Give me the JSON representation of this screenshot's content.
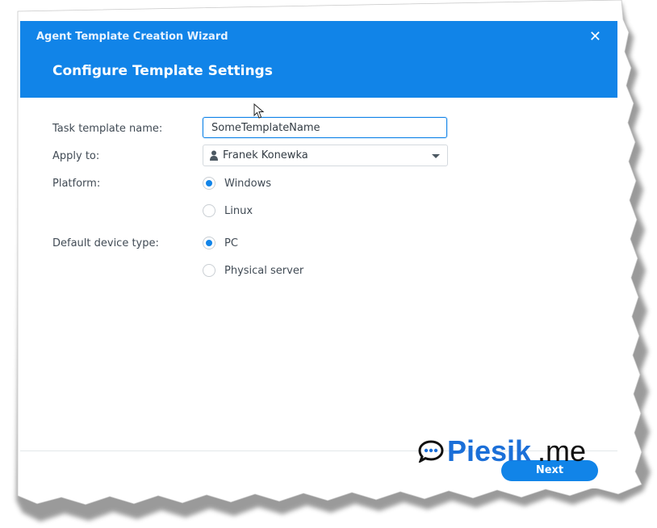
{
  "wizard": {
    "title": "Agent Template Creation Wizard",
    "step_title": "Configure Template Settings",
    "close_glyph": "✕"
  },
  "form": {
    "template_name_label": "Task template name:",
    "template_name_value": "SomeTemplateName",
    "apply_to_label": "Apply to:",
    "apply_to_value": "Franek Konewka",
    "apply_to_icon": "user-icon",
    "platform_label": "Platform:",
    "platform_options": [
      {
        "label": "Windows",
        "checked": true
      },
      {
        "label": "Linux",
        "checked": false
      }
    ],
    "device_type_label": "Default device type:",
    "device_type_options": [
      {
        "label": "PC",
        "checked": true
      },
      {
        "label": "Physical server",
        "checked": false
      }
    ]
  },
  "footer": {
    "next_label": "Next"
  },
  "watermark": {
    "brand": "Piesik",
    "suffix": ".me",
    "icon": "chat-bubble-icon"
  },
  "colors": {
    "accent": "#1184e8",
    "header_bg": "#1184e8",
    "label_text": "#414b55",
    "watermark_blue": "#1b6fd8"
  }
}
